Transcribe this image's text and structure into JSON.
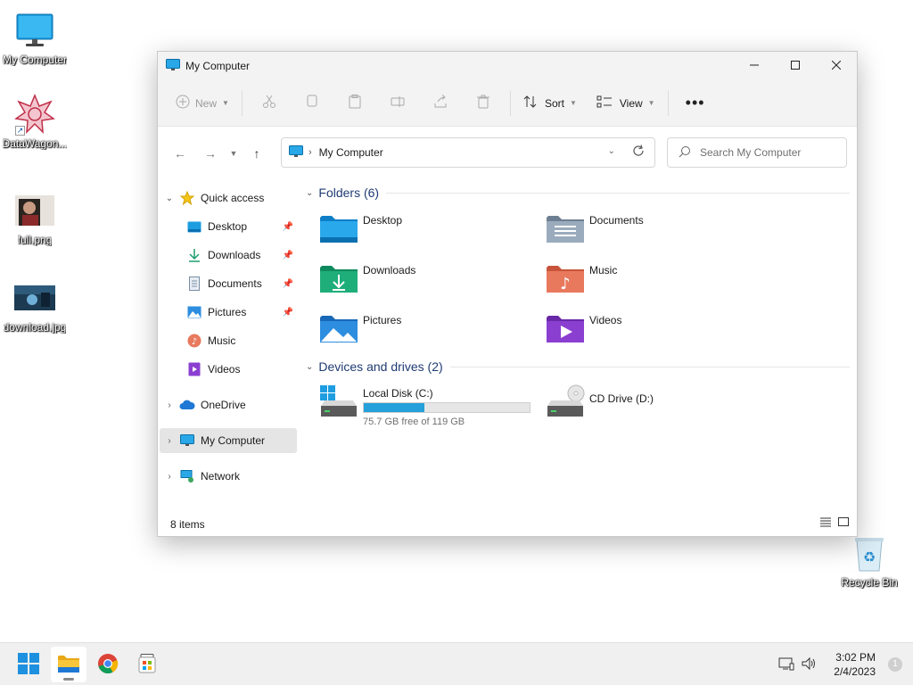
{
  "desktop": {
    "icons": [
      {
        "label": "My Computer",
        "icon": "monitor-icon"
      },
      {
        "label": "DataWagon...",
        "icon": "datawagon-app-icon"
      },
      {
        "label": "full.png",
        "icon": "image-thumbnail"
      },
      {
        "label": "download.jpg",
        "icon": "image-thumbnail"
      },
      {
        "label": "Recycle Bin",
        "icon": "recycle-bin-icon"
      }
    ]
  },
  "window": {
    "title": "My Computer",
    "controls": {
      "minimize": "minimize-icon",
      "maximize": "maximize-icon",
      "close": "close-icon"
    },
    "commandbar": {
      "new_label": "New",
      "sort_label": "Sort",
      "view_label": "View",
      "more": "more-options-icon"
    },
    "address": {
      "location": "My Computer"
    },
    "search": {
      "placeholder": "Search My Computer"
    },
    "nav": {
      "quick_access": "Quick access",
      "items": [
        {
          "label": "Desktop",
          "icon": "desktop-folder-icon",
          "pinned": true
        },
        {
          "label": "Downloads",
          "icon": "downloads-icon",
          "pinned": true
        },
        {
          "label": "Documents",
          "icon": "documents-icon",
          "pinned": true
        },
        {
          "label": "Pictures",
          "icon": "pictures-icon",
          "pinned": true
        },
        {
          "label": "Music",
          "icon": "music-icon",
          "pinned": false
        },
        {
          "label": "Videos",
          "icon": "videos-icon",
          "pinned": false
        }
      ],
      "onedrive": "OneDrive",
      "mycomputer": "My Computer",
      "network": "Network"
    },
    "content": {
      "folders_header": "Folders (6)",
      "folders": [
        {
          "name": "Desktop",
          "icon": "desktop-folder-icon"
        },
        {
          "name": "Documents",
          "icon": "documents-folder-icon"
        },
        {
          "name": "Downloads",
          "icon": "downloads-folder-icon"
        },
        {
          "name": "Music",
          "icon": "music-folder-icon"
        },
        {
          "name": "Pictures",
          "icon": "pictures-folder-icon"
        },
        {
          "name": "Videos",
          "icon": "videos-folder-icon"
        }
      ],
      "drives_header": "Devices and drives (2)",
      "drives": [
        {
          "name": "Local Disk (C:)",
          "free_text": "75.7 GB free of 119 GB",
          "used_fraction": 0.364
        },
        {
          "name": "CD Drive (D:)"
        }
      ]
    },
    "status": {
      "items_count": "8 items"
    }
  },
  "taskbar": {
    "apps": [
      "start-icon",
      "file-explorer-icon",
      "chrome-icon",
      "store-icon"
    ],
    "clock": {
      "time": "3:02 PM",
      "date": "2/4/2023"
    },
    "notifications": "1"
  },
  "colors": {
    "accent": "#26a0da",
    "section_header": "#1f3b73"
  }
}
